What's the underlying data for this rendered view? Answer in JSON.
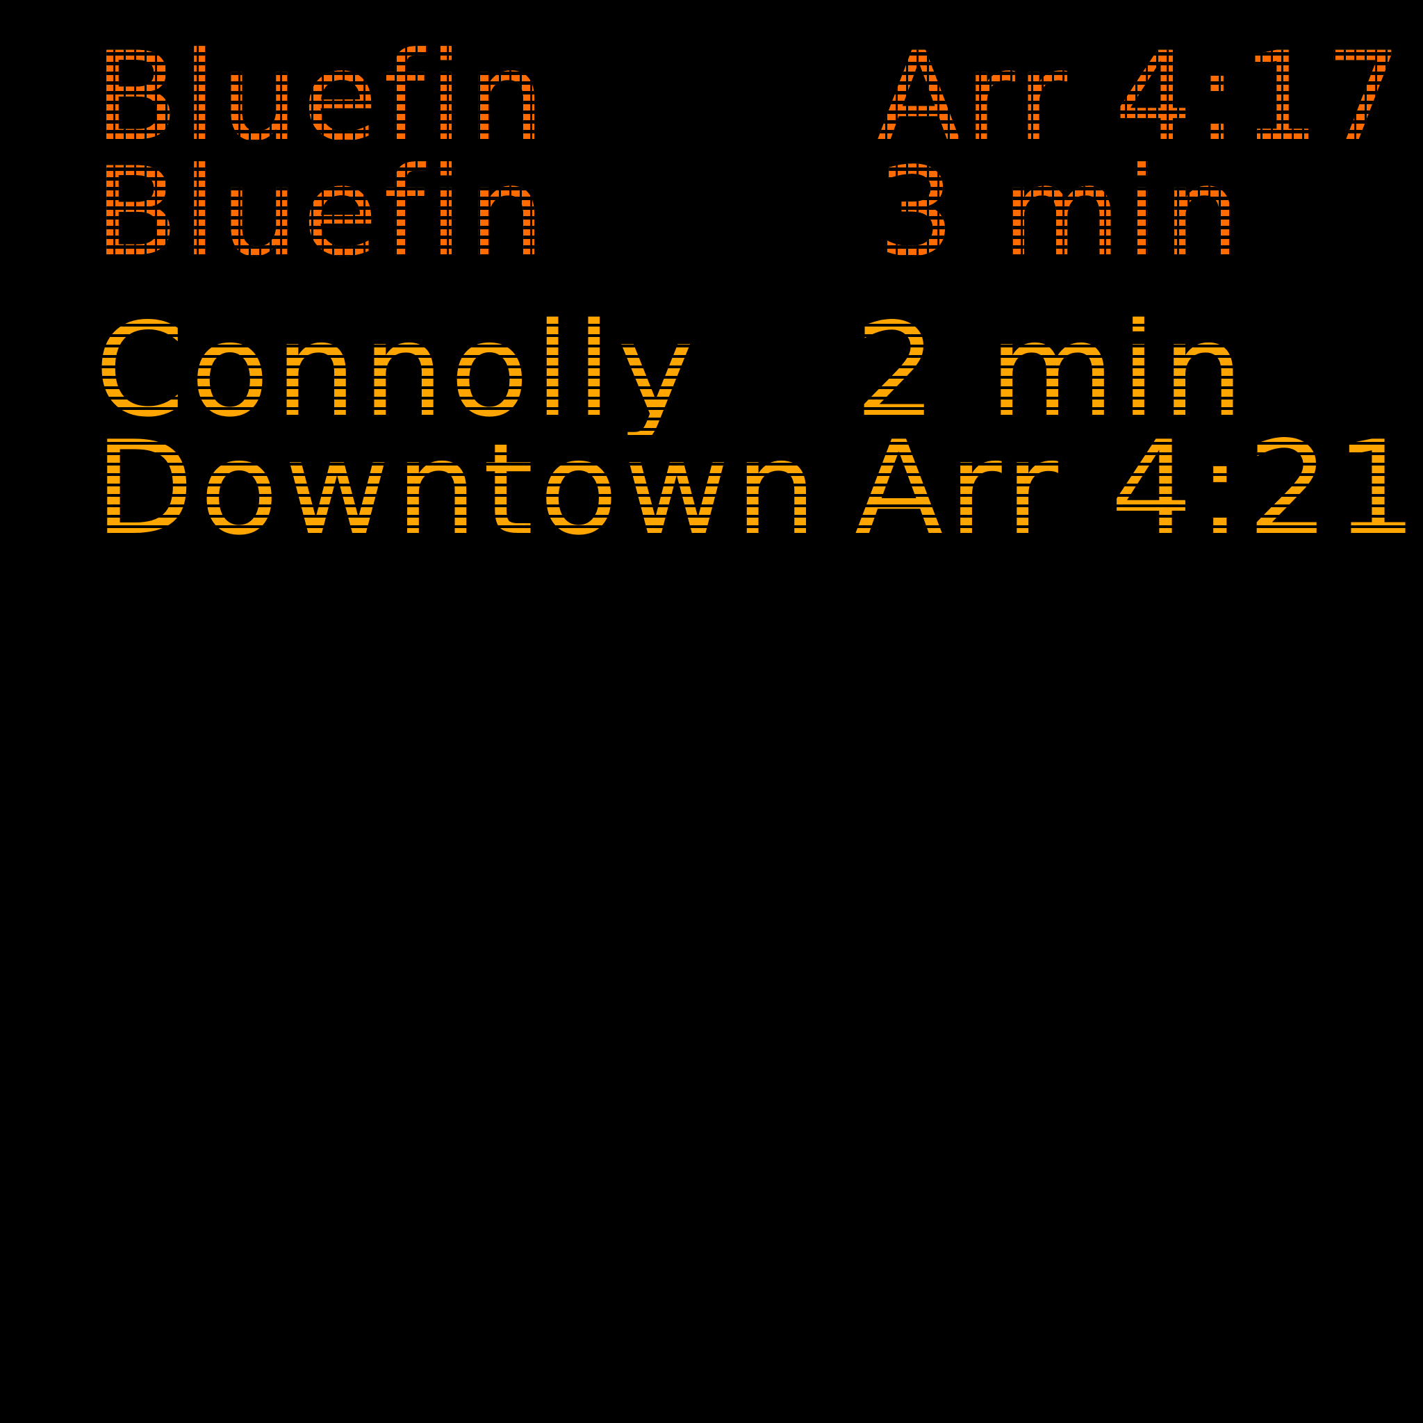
{
  "board": {
    "accent_color": "#ffa500",
    "background_color": "#000000",
    "rows": [
      {
        "destination": "Bluefin",
        "time": "Arr 4:17"
      },
      {
        "destination": "Bluefin",
        "time": "3 min"
      },
      {
        "destination": "Connolly",
        "time": "2 min"
      },
      {
        "destination": "Downtown",
        "time": "Arr 4:21"
      }
    ]
  }
}
